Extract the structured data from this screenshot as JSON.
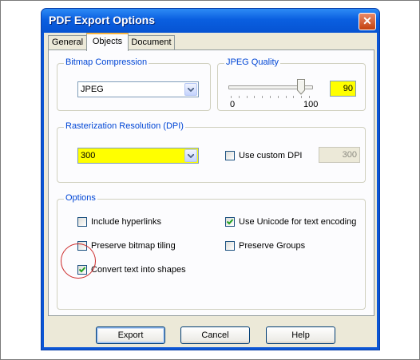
{
  "window": {
    "title": "PDF Export Options",
    "close_label": "✕"
  },
  "tabs": [
    {
      "label": "General",
      "active": false
    },
    {
      "label": "Objects",
      "active": true
    },
    {
      "label": "Document",
      "active": false
    }
  ],
  "bitmap_compression": {
    "label": "Bitmap Compression",
    "value": "JPEG"
  },
  "jpeg_quality": {
    "label": "JPEG Quality",
    "value": "90",
    "min_label": "0",
    "max_label": "100",
    "level": 90
  },
  "rasterization": {
    "label": "Rasterization Resolution (DPI)",
    "value": "300",
    "custom_dpi_label": "Use custom DPI",
    "custom_dpi_checked": false,
    "custom_dpi_value": "300"
  },
  "options": {
    "label": "Options",
    "items": [
      {
        "label": "Include hyperlinks",
        "checked": false
      },
      {
        "label": "Use Unicode for text encoding",
        "checked": true
      },
      {
        "label": "Preserve bitmap tiling",
        "checked": false
      },
      {
        "label": "Preserve Groups",
        "checked": false
      },
      {
        "label": "Convert text into shapes",
        "checked": true
      }
    ]
  },
  "buttons": {
    "export": "Export",
    "cancel": "Cancel",
    "help": "Help"
  },
  "colors": {
    "highlight": "#ffff00",
    "title_blue": "#0a5fe0",
    "group_label": "#0046d5",
    "annotation": "#cc2a2a"
  }
}
